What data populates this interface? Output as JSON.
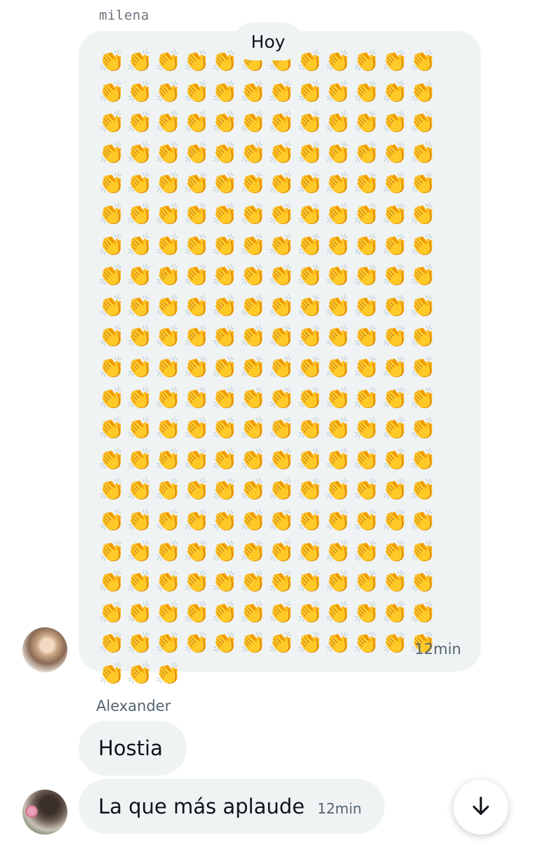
{
  "conversation": {
    "first_sender": "milena",
    "day_divider": "Hoy",
    "clap_message": {
      "emoji": "👏",
      "count": 243,
      "time": "12min"
    },
    "second_sender": "Alexander",
    "messages": [
      {
        "text": "Hostia"
      },
      {
        "text": "La que más aplaude",
        "time": "12min"
      }
    ]
  },
  "icons": {
    "scroll_down": "arrow-down-icon"
  }
}
